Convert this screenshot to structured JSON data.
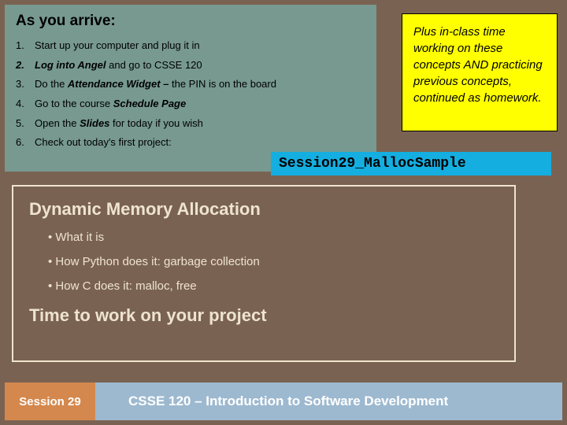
{
  "arrive": {
    "title": "As you arrive:",
    "items": [
      {
        "num": "1.",
        "text_pre": "Start up your computer and plug it in",
        "bold": "",
        "text_post": ""
      },
      {
        "num": "2.",
        "text_pre": "",
        "bold": "Log into Angel",
        "text_post": " and go to CSSE 120",
        "num_bold": true
      },
      {
        "num": "3.",
        "text_pre": "Do the ",
        "bold": "Attendance Widget –",
        "text_post": " the PIN is on the board"
      },
      {
        "num": "4.",
        "text_pre": "Go to the course ",
        "bold": "Schedule Page",
        "text_post": ""
      },
      {
        "num": "5.",
        "text_pre": "Open the ",
        "bold": "Slides",
        "text_post": " for today if you wish"
      },
      {
        "num": "6.",
        "text_pre": "Check out today's first project:",
        "bold": "",
        "text_post": ""
      }
    ]
  },
  "yellow_note": "Plus in-class time working on these concepts AND practicing previous concepts, continued as homework.",
  "project_name": "Session29_MallocSample",
  "outline": {
    "title": "Dynamic Memory Allocation",
    "bullets": [
      "What it is",
      "How Python does it:  garbage collection",
      "How C does it:  malloc, free"
    ],
    "subtitle": "Time to work on your project"
  },
  "footer": {
    "session": "Session 29",
    "course": "CSSE 120 – Introduction to Software Development"
  }
}
